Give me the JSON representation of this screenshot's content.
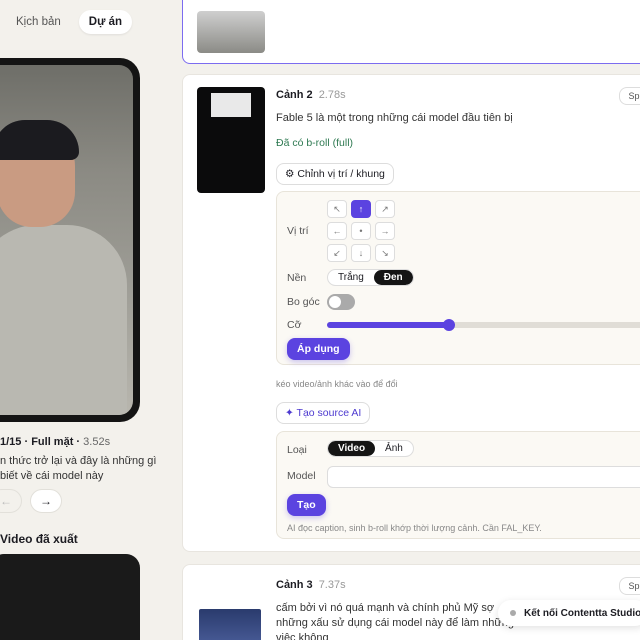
{
  "tabs": [
    {
      "label": "Kịch bản",
      "active": false
    },
    {
      "label": "Dự án",
      "active": true
    }
  ],
  "preview": {
    "index": "1/15",
    "mode": "Full mặt",
    "duration": "3.52s",
    "caption": "n thức trở lại và đây là những gì biết về cái model này",
    "prev_icon": "←",
    "next_icon": "→",
    "exported_title": "Video đã xuất"
  },
  "scene2": {
    "title": "Cảnh 2",
    "duration": "2.78s",
    "split_label": "Split",
    "text": "Fable 5 là một trong những cái model đầu tiên bị",
    "broll_status": "Đã có b-roll (full)",
    "adjust_button": "⚙ Chỉnh vị trí / khung",
    "position_label": "Vị trí",
    "position_icons": [
      "↖",
      "↑",
      "↗",
      "←",
      "•",
      "→",
      "↙",
      "↓",
      "↘"
    ],
    "position_active": 1,
    "background_label": "Nền",
    "background_options": [
      "Trắng",
      "Đen"
    ],
    "background_selected": "Đen",
    "radius_label": "Bo góc",
    "size_label": "Cỡ",
    "size_value": 0.37,
    "apply_button": "Áp dụng",
    "drag_hint": "kéo video/ảnh khác vào để đổi",
    "ai_button": "✦ Tạo source AI",
    "type_label": "Loại",
    "type_options": [
      "Video",
      "Ảnh"
    ],
    "type_selected": "Video",
    "model_label": "Model",
    "create_button": "Tạo",
    "ai_hint": "AI đọc caption, sinh b-roll khớp thời lượng cảnh. Cần FAL_KEY."
  },
  "scene3": {
    "title": "Cảnh 3",
    "duration": "7.37s",
    "split_label": "Split",
    "text": "cấm bởi vì nó quá mạnh và chính phủ Mỹ sợ những xấu sử dụng cái model này để làm những việc không"
  },
  "toast": {
    "label": "Kết nối Contentta Studio"
  },
  "colors": {
    "accent": "#5b43e0",
    "success": "#2f7a52"
  }
}
